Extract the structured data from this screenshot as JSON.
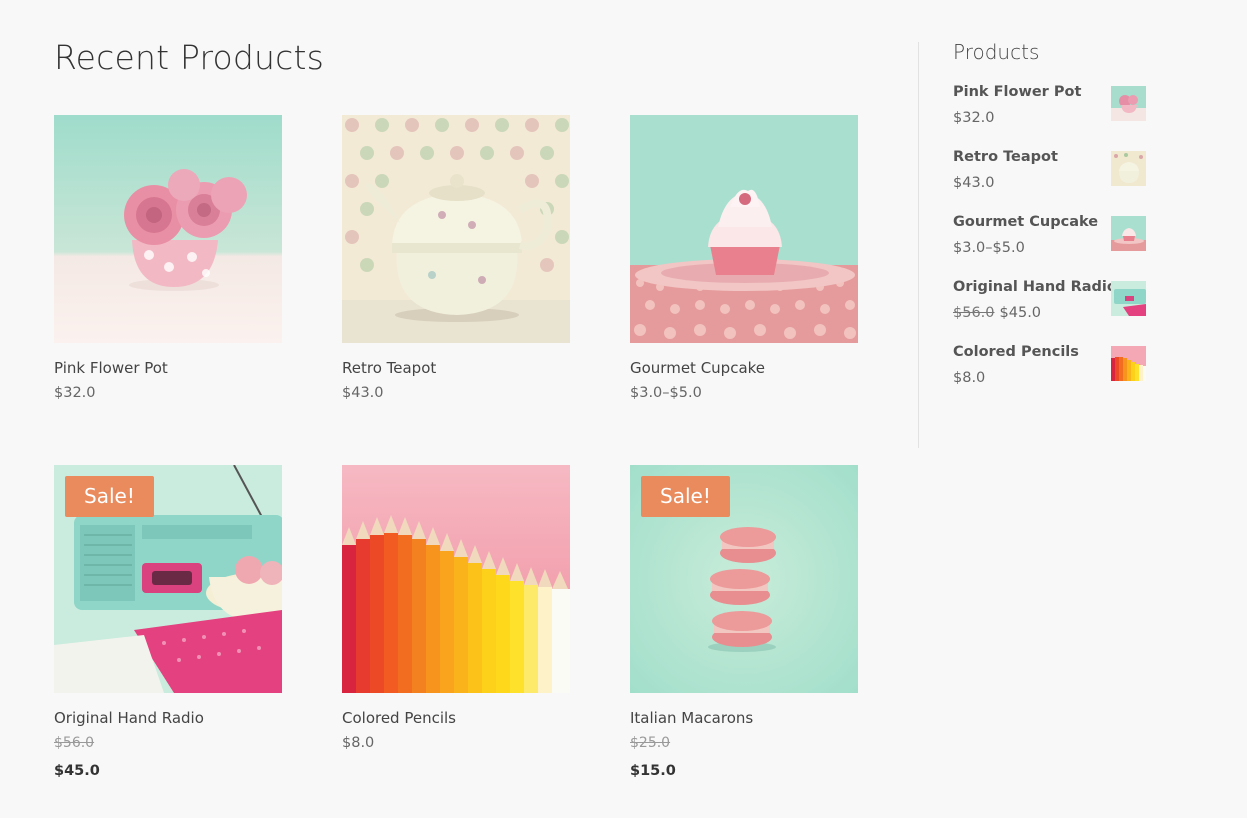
{
  "main": {
    "title": "Recent Products",
    "products": [
      {
        "name": "Pink Flower Pot",
        "price": "$32.0",
        "image": "pink-flower-pot-image"
      },
      {
        "name": "Retro Teapot",
        "price": "$43.0",
        "image": "retro-teapot-image"
      },
      {
        "name": "Gourmet Cupcake",
        "price": "$3.0–$5.0",
        "image": "gourmet-cupcake-image"
      },
      {
        "name": "Original Hand Radio",
        "old_price": "$56.0",
        "price": "$45.0",
        "sale": "Sale!",
        "image": "hand-radio-image"
      },
      {
        "name": "Colored Pencils",
        "price": "$8.0",
        "image": "colored-pencils-image"
      },
      {
        "name": "Italian Macarons",
        "old_price": "$25.0",
        "price": "$15.0",
        "sale": "Sale!",
        "image": "macarons-image"
      }
    ]
  },
  "sidebar": {
    "title": "Products",
    "items": [
      {
        "name": "Pink Flower Pot",
        "price": "$32.0"
      },
      {
        "name": "Retro Teapot",
        "price": "$43.0"
      },
      {
        "name": "Gourmet Cupcake",
        "price": "$3.0–$5.0"
      },
      {
        "name": "Original Hand Radio",
        "old_price": "$56.0",
        "price": "$45.0"
      },
      {
        "name": "Colored Pencils",
        "price": "$8.0"
      }
    ]
  },
  "colors": {
    "background": "#f8f8f8",
    "sale_badge": "#e98b5d",
    "mint": "#a8e0d2",
    "pink": "#f2a2b0"
  }
}
